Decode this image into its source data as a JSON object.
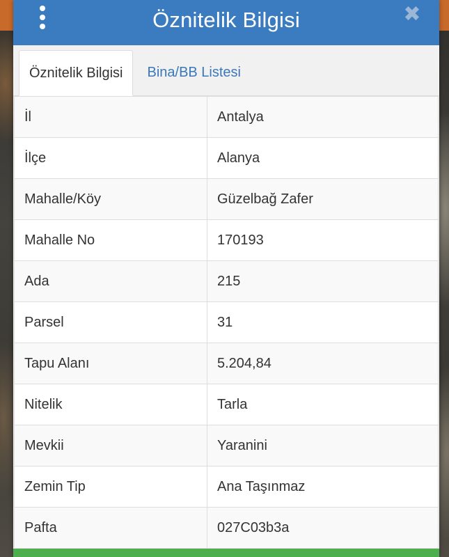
{
  "header": {
    "title": "Öznitelik Bilgisi",
    "close_symbol": "✖"
  },
  "tabs": [
    {
      "label": "Öznitelik Bilgisi",
      "active": true
    },
    {
      "label": "Bina/BB Listesi",
      "active": false
    }
  ],
  "rows": [
    {
      "key": "İl",
      "value": "Antalya"
    },
    {
      "key": "İlçe",
      "value": "Alanya"
    },
    {
      "key": "Mahalle/Köy",
      "value": "Güzelbağ Zafer"
    },
    {
      "key": "Mahalle No",
      "value": "170193"
    },
    {
      "key": "Ada",
      "value": "215"
    },
    {
      "key": "Parsel",
      "value": "31"
    },
    {
      "key": "Tapu Alanı",
      "value": "5.204,84"
    },
    {
      "key": "Nitelik",
      "value": "Tarla"
    },
    {
      "key": "Mevkii",
      "value": "Yaranini"
    },
    {
      "key": "Zemin Tip",
      "value": "Ana Taşınmaz"
    },
    {
      "key": "Pafta",
      "value": "027C03b3a"
    }
  ],
  "colors": {
    "header": "#3b7cc1",
    "tab_link": "#3a78b9",
    "bottom_bar": "#4cae4c"
  },
  "icons": {
    "menu": "vertical-dots-menu-icon",
    "close": "close-icon"
  }
}
